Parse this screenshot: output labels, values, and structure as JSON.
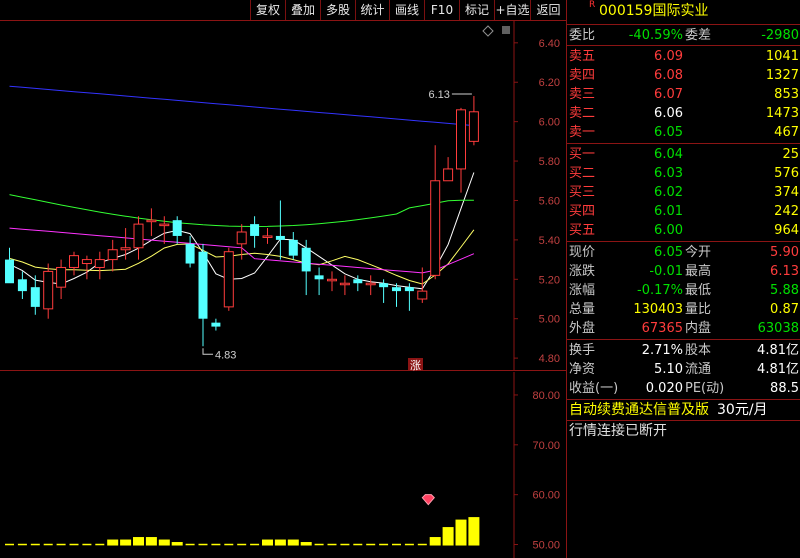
{
  "toolbar": {
    "buttons": [
      "复权",
      "叠加",
      "多股",
      "统计",
      "画线",
      "F10",
      "标记",
      "+自选",
      "返回"
    ]
  },
  "stock": {
    "marker": "R",
    "code": "000159",
    "name": "国际实业"
  },
  "orderbook": {
    "ratio_label": "委比",
    "ratio_value": "-40.59%",
    "diff_label": "委差",
    "diff_value": "-2980",
    "asks": [
      {
        "label": "卖五",
        "price": "6.09",
        "vol": "1041"
      },
      {
        "label": "卖四",
        "price": "6.08",
        "vol": "1327"
      },
      {
        "label": "卖三",
        "price": "6.07",
        "vol": "853"
      },
      {
        "label": "卖二",
        "price": "6.06",
        "vol": "1473"
      },
      {
        "label": "卖一",
        "price": "6.05",
        "vol": "467"
      }
    ],
    "bids": [
      {
        "label": "买一",
        "price": "6.04",
        "vol": "25"
      },
      {
        "label": "买二",
        "price": "6.03",
        "vol": "576"
      },
      {
        "label": "买三",
        "price": "6.02",
        "vol": "374"
      },
      {
        "label": "买四",
        "price": "6.01",
        "vol": "242"
      },
      {
        "label": "买五",
        "price": "6.00",
        "vol": "964"
      }
    ]
  },
  "stats": [
    {
      "l1": "现价",
      "v1": "6.05",
      "l2": "今开",
      "v2": "5.90"
    },
    {
      "l1": "涨跌",
      "v1": "-0.01",
      "l2": "最高",
      "v2": "6.13"
    },
    {
      "l1": "涨幅",
      "v1": "-0.17%",
      "l2": "最低",
      "v2": "5.88"
    },
    {
      "l1": "总量",
      "v1": "130403",
      "l2": "量比",
      "v2": "0.87"
    },
    {
      "l1": "外盘",
      "v1": "67365",
      "l2": "内盘",
      "v2": "63038"
    }
  ],
  "stats2": [
    {
      "l1": "换手",
      "v1": "2.71%",
      "l2": "股本",
      "v2": "4.81亿"
    },
    {
      "l1": "净资",
      "v1": "5.10",
      "l2": "流通",
      "v2": "4.81亿"
    },
    {
      "l1": "收益(一)",
      "v1": "0.020",
      "l2": "PE(动)",
      "v2": "88.5"
    }
  ],
  "banners": {
    "subscription": "自动续费通达信普及版",
    "price": "30元/月",
    "status": "行情连接已断开"
  },
  "chart_data": [
    {
      "type": "candlestick",
      "y_ticks": [
        "6.40",
        "6.20",
        "6.00",
        "5.80",
        "5.60",
        "5.40",
        "5.20",
        "5.00",
        "4.80"
      ],
      "ylim": [
        4.76,
        6.46
      ],
      "annotations": {
        "high": "6.13",
        "low": "4.83",
        "limit_tag": "涨"
      },
      "candles": [
        {
          "o": 5.3,
          "h": 5.36,
          "l": 5.2,
          "c": 5.18
        },
        {
          "o": 5.2,
          "h": 5.24,
          "l": 5.1,
          "c": 5.14
        },
        {
          "o": 5.16,
          "h": 5.22,
          "l": 5.02,
          "c": 5.06
        },
        {
          "o": 5.05,
          "h": 5.28,
          "l": 5.0,
          "c": 5.24
        },
        {
          "o": 5.16,
          "h": 5.3,
          "l": 5.1,
          "c": 5.26
        },
        {
          "o": 5.26,
          "h": 5.34,
          "l": 5.22,
          "c": 5.32
        },
        {
          "o": 5.28,
          "h": 5.32,
          "l": 5.2,
          "c": 5.3
        },
        {
          "o": 5.26,
          "h": 5.34,
          "l": 5.2,
          "c": 5.3
        },
        {
          "o": 5.3,
          "h": 5.4,
          "l": 5.24,
          "c": 5.35
        },
        {
          "o": 5.35,
          "h": 5.46,
          "l": 5.3,
          "c": 5.36
        },
        {
          "o": 5.36,
          "h": 5.52,
          "l": 5.3,
          "c": 5.48
        },
        {
          "o": 5.5,
          "h": 5.56,
          "l": 5.42,
          "c": 5.5
        },
        {
          "o": 5.48,
          "h": 5.52,
          "l": 5.38,
          "c": 5.48
        },
        {
          "o": 5.5,
          "h": 5.52,
          "l": 5.38,
          "c": 5.42
        },
        {
          "o": 5.38,
          "h": 5.42,
          "l": 5.26,
          "c": 5.28
        },
        {
          "o": 5.34,
          "h": 5.38,
          "l": 4.86,
          "c": 5.0
        },
        {
          "o": 4.98,
          "h": 5.0,
          "l": 4.94,
          "c": 4.96
        },
        {
          "o": 5.06,
          "h": 5.36,
          "l": 5.04,
          "c": 5.34
        },
        {
          "o": 5.38,
          "h": 5.48,
          "l": 5.3,
          "c": 5.44
        },
        {
          "o": 5.48,
          "h": 5.52,
          "l": 5.36,
          "c": 5.42
        },
        {
          "o": 5.42,
          "h": 5.46,
          "l": 5.38,
          "c": 5.42
        },
        {
          "o": 5.42,
          "h": 5.6,
          "l": 5.3,
          "c": 5.4
        },
        {
          "o": 5.4,
          "h": 5.44,
          "l": 5.3,
          "c": 5.32
        },
        {
          "o": 5.36,
          "h": 5.4,
          "l": 5.12,
          "c": 5.24
        },
        {
          "o": 5.22,
          "h": 5.26,
          "l": 5.12,
          "c": 5.2
        },
        {
          "o": 5.2,
          "h": 5.24,
          "l": 5.14,
          "c": 5.2
        },
        {
          "o": 5.18,
          "h": 5.22,
          "l": 5.12,
          "c": 5.18
        },
        {
          "o": 5.2,
          "h": 5.22,
          "l": 5.14,
          "c": 5.18
        },
        {
          "o": 5.18,
          "h": 5.22,
          "l": 5.12,
          "c": 5.18
        },
        {
          "o": 5.18,
          "h": 5.2,
          "l": 5.08,
          "c": 5.16
        },
        {
          "o": 5.16,
          "h": 5.18,
          "l": 5.06,
          "c": 5.14
        },
        {
          "o": 5.16,
          "h": 5.18,
          "l": 5.04,
          "c": 5.14
        },
        {
          "o": 5.1,
          "h": 5.26,
          "l": 5.08,
          "c": 5.14
        },
        {
          "o": 5.22,
          "h": 5.88,
          "l": 5.2,
          "c": 5.7
        },
        {
          "o": 5.7,
          "h": 5.82,
          "l": 5.7,
          "c": 5.76
        },
        {
          "o": 5.76,
          "h": 6.07,
          "l": 5.64,
          "c": 6.06
        },
        {
          "o": 5.9,
          "h": 6.13,
          "l": 5.88,
          "c": 6.05
        }
      ],
      "moving_averages": [
        {
          "name": "MA5",
          "color": "#ffffff"
        },
        {
          "name": "MA10",
          "color": "#ffff66"
        },
        {
          "name": "MA20",
          "color": "#ff33ff"
        },
        {
          "name": "MA60",
          "color": "#33ff33"
        },
        {
          "name": "MA120",
          "color": "#3333ff"
        }
      ]
    },
    {
      "type": "bar",
      "y_ticks": [
        "80.00",
        "70.00",
        "60.00",
        "50.00"
      ],
      "ylim": [
        48.5,
        83
      ],
      "values": [
        50,
        50,
        50,
        50,
        50,
        50,
        50,
        50,
        51,
        51,
        51.5,
        51.5,
        51,
        50.5,
        50,
        50,
        50,
        50,
        50,
        50,
        51,
        51,
        51,
        50.5,
        50,
        50,
        50,
        50,
        50,
        50,
        50,
        50,
        50,
        51.5,
        53.5,
        55,
        55.5
      ]
    }
  ]
}
